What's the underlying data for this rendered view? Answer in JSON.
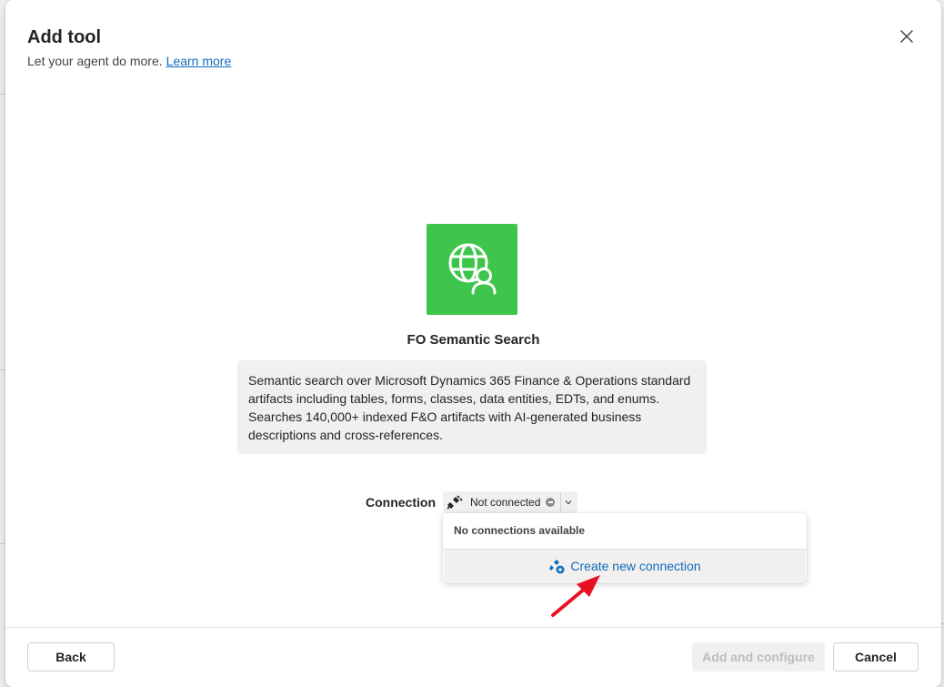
{
  "dialog": {
    "title": "Add tool",
    "subtitle": "Let your agent do more.",
    "learn_more": "Learn more",
    "close_icon": "close-icon"
  },
  "tool": {
    "name": "FO Semantic Search",
    "icon": "globe-person-icon",
    "icon_color": "#3fc54b",
    "description": "Semantic search over Microsoft Dynamics 365 Finance & Operations standard artifacts including tables, forms, classes, data entities, EDTs, and enums. Searches 140,000+ indexed F&O artifacts with AI-generated business descriptions and cross-references."
  },
  "connection": {
    "label": "Connection",
    "status": "Not connected",
    "dropdown": {
      "empty_text": "No connections available",
      "create_label": "Create new connection"
    }
  },
  "footer": {
    "back_label": "Back",
    "add_label": "Add and configure",
    "cancel_label": "Cancel"
  },
  "colors": {
    "accent": "#0f6cbd",
    "annotation_arrow": "#e81123"
  }
}
